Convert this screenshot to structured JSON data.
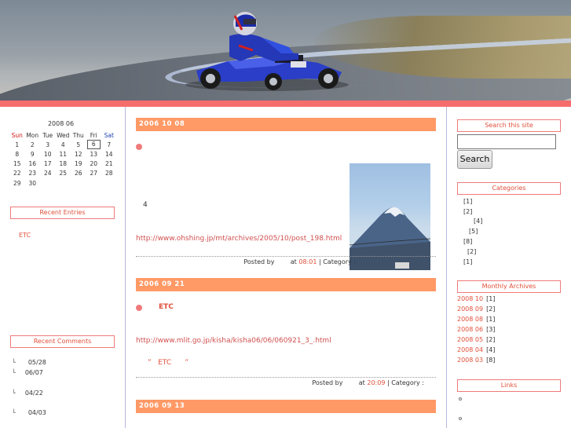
{
  "calendar": {
    "caption": "2008 06",
    "weekdays": [
      "Sun",
      "Mon",
      "Tue",
      "Wed",
      "Thu",
      "Fri",
      "Sat"
    ],
    "weeks": [
      [
        "1",
        "2",
        "3",
        "4",
        "5",
        "6",
        "7"
      ],
      [
        "8",
        "9",
        "10",
        "11",
        "12",
        "13",
        "14"
      ],
      [
        "15",
        "16",
        "17",
        "18",
        "19",
        "20",
        "21"
      ],
      [
        "22",
        "23",
        "24",
        "25",
        "26",
        "27",
        "28"
      ],
      [
        "29",
        "30",
        "",
        "",
        "",
        "",
        ""
      ]
    ],
    "today": "6"
  },
  "left": {
    "recent_entries_title": "Recent Entries",
    "recent_entries": [
      "ETC"
    ],
    "recent_comments_title": "Recent Comments",
    "recent_comments": [
      {
        "bracket": "└",
        "date": "05/28"
      },
      {
        "bracket": "└",
        "date": "06/07"
      },
      {
        "bracket": "└",
        "date": "04/22"
      },
      {
        "bracket": "└",
        "date": "04/03"
      }
    ]
  },
  "entries": [
    {
      "date": "2006  10  08",
      "title": "",
      "text": "4",
      "link": "http://www.ohshing.jp/mt/archives/2005/10/post_198.html",
      "footer_prefix": "Posted by        at ",
      "time": "08:01",
      "footer_suffix": " | Category :"
    },
    {
      "date": "2006  09  21",
      "title": "ETC",
      "link": "http://www.mlit.go.jp/kisha/kisha06/06/060921_3_.html",
      "quote": "”   ETC      ”",
      "footer_prefix": "Posted by        at ",
      "time": "20:09",
      "footer_suffix": " | Category :"
    },
    {
      "date": "2006  09  13"
    }
  ],
  "right": {
    "search_title": "Search this site",
    "search_value": "",
    "search_button": "Search",
    "categories_title": "Categories",
    "categories": [
      "[1]",
      "[2]",
      "[4]",
      "[5]",
      "[8]",
      "[2]",
      "[1]"
    ],
    "archives_title": "Monthly Archives",
    "archives": [
      {
        "month": "2008 10",
        "count": "[1]"
      },
      {
        "month": "2008 09",
        "count": "[2]"
      },
      {
        "month": "2008 08",
        "count": "[1]"
      },
      {
        "month": "2008 06",
        "count": "[3]"
      },
      {
        "month": "2008 05",
        "count": "[2]"
      },
      {
        "month": "2008 04",
        "count": "[4]"
      },
      {
        "month": "2008 03",
        "count": "[8]"
      }
    ],
    "links_title": "Links"
  },
  "colors": {
    "accent_bar": "#f66d6d",
    "date_bar": "#ff9966",
    "link": "#e0503a"
  }
}
